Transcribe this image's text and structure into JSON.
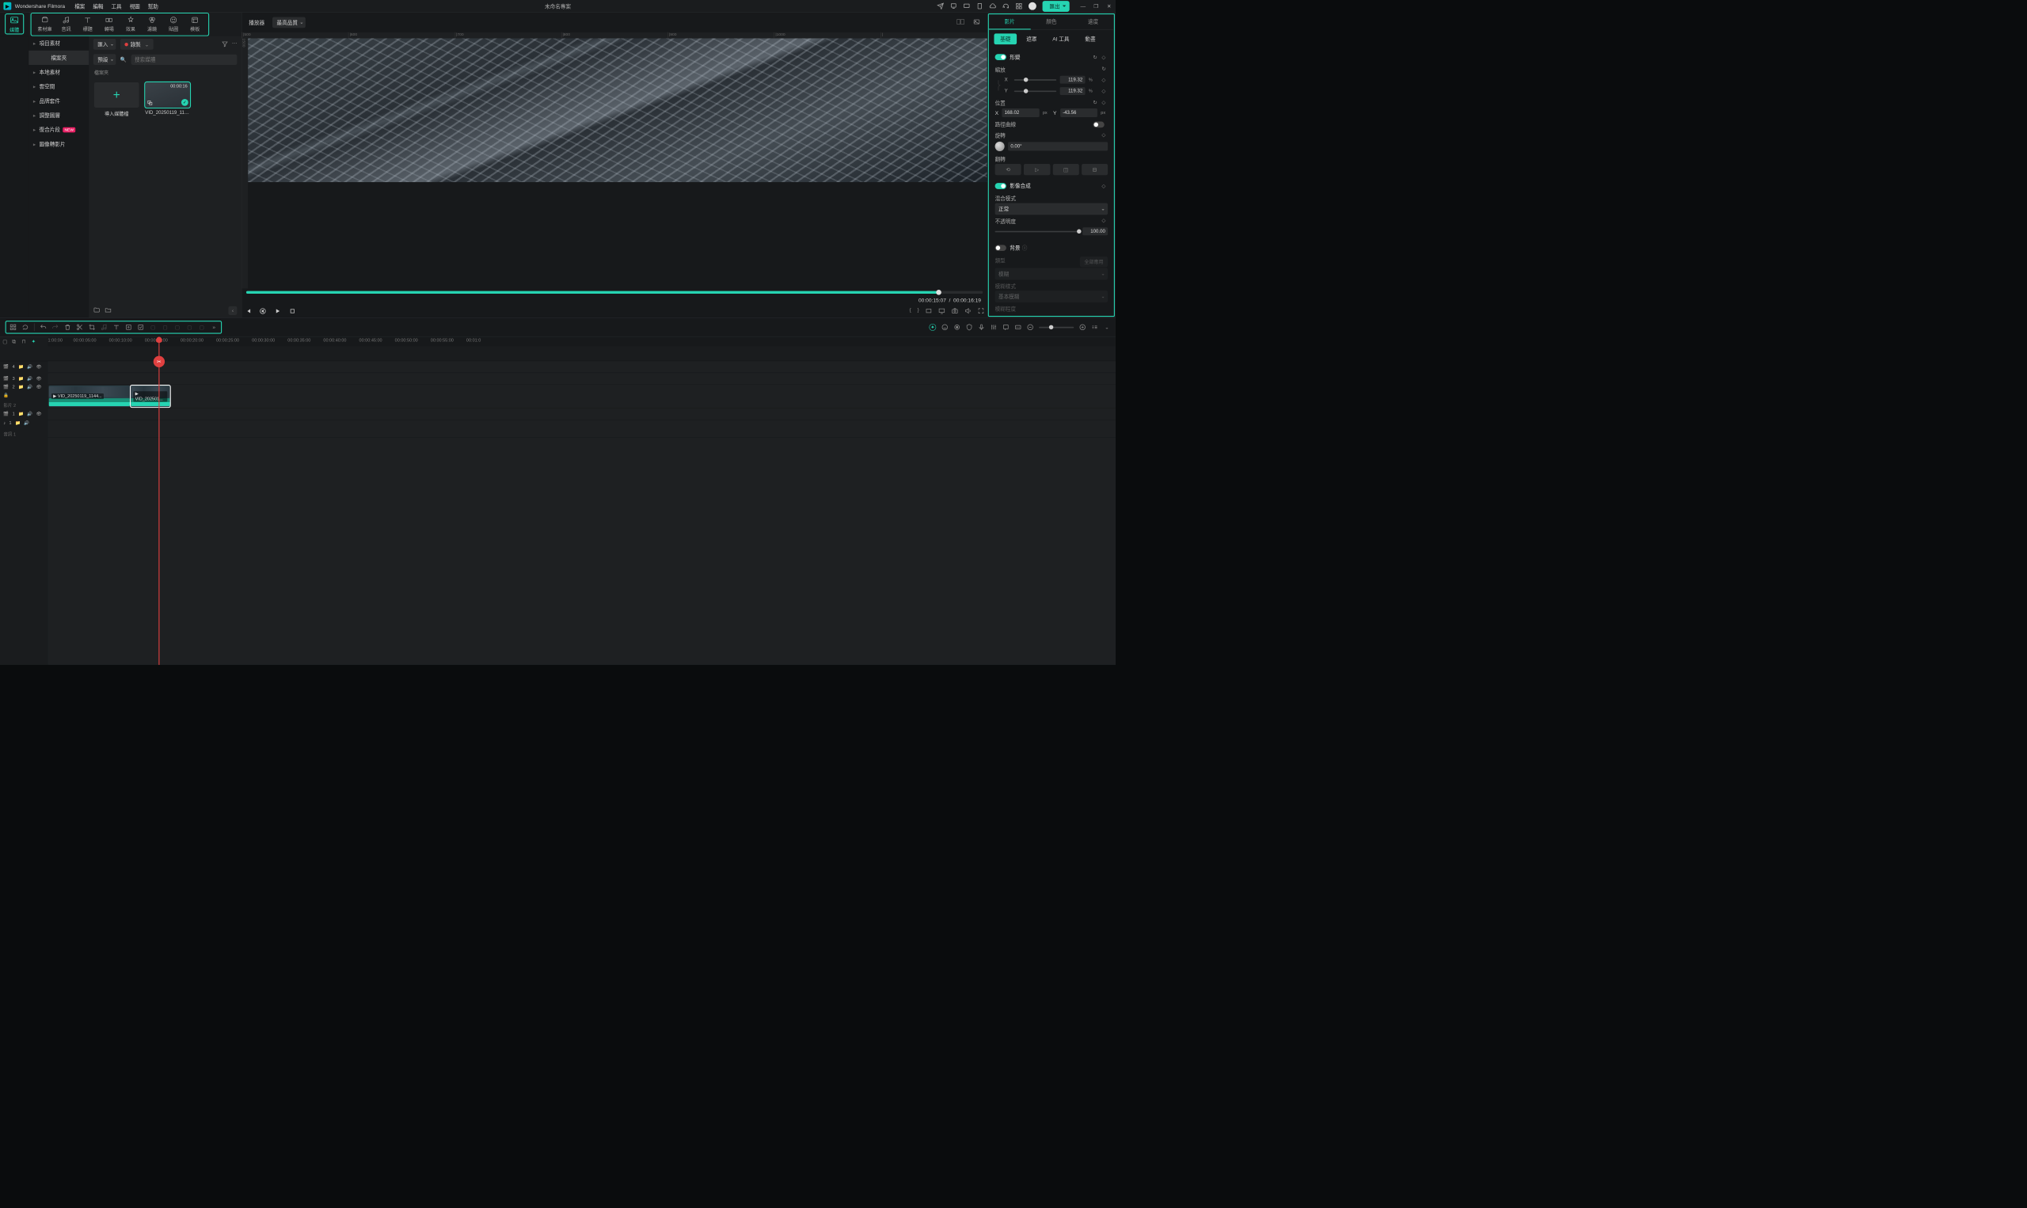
{
  "app": {
    "name": "Wondershare Filmora",
    "project": "未命名專案"
  },
  "menu": [
    "檔案",
    "編輯",
    "工具",
    "視圖",
    "幫助"
  ],
  "export_label": "匯出",
  "asset_tabs": {
    "active": "媒體",
    "items": [
      "素材庫",
      "音訊",
      "標題",
      "轉場",
      "效果",
      "濾鏡",
      "貼圖",
      "模板"
    ]
  },
  "sidebar": {
    "items": [
      {
        "label": "項目素材"
      },
      {
        "label": "檔案夾",
        "active": true,
        "sub": true
      },
      {
        "label": "本地素材"
      },
      {
        "label": "雲空間"
      },
      {
        "label": "品牌套件"
      },
      {
        "label": "調整圖層"
      },
      {
        "label": "復合片段",
        "badge": "NEW"
      },
      {
        "label": "圖像轉影片"
      }
    ]
  },
  "asset_toolbar": {
    "import": "匯入",
    "record": "錄製",
    "preset": "預設",
    "search_ph": "搜索媒體",
    "folder_label": "檔案夾"
  },
  "assets": {
    "import_label": "導入媒體檔",
    "clip": {
      "name": "VID_20250119_1144...",
      "duration": "00:00:16"
    }
  },
  "player": {
    "label": "播放器",
    "quality": "最高品質",
    "current": "00:00:15:07",
    "total": "00:00:16:19"
  },
  "right_panel": {
    "tabs": [
      "影片",
      "顏色",
      "速度"
    ],
    "subtabs": [
      "基礎",
      "遮罩",
      "AI 工具",
      "動畫"
    ],
    "transform": "形變",
    "scale": {
      "label": "縮放",
      "x": "119.32",
      "y": "119.32",
      "unit": "%"
    },
    "position": {
      "label": "位置",
      "x": "168.02",
      "y": "-43.56",
      "unit": "px"
    },
    "path_curve": "路徑曲線",
    "rotation": {
      "label": "旋轉",
      "value": "0.00°"
    },
    "flip": "翻轉",
    "compositing": {
      "label": "影像合成",
      "blend_label": "混合模式",
      "blend_value": "正常",
      "opacity_label": "不透明度",
      "opacity_value": "100.00"
    },
    "background": {
      "label": "背景",
      "type_label": "類型",
      "type_value": "模糊",
      "style_label": "模糊樣式",
      "style_value": "基本模糊",
      "degree_label": "模糊程度",
      "apply_all": "全部應用"
    }
  },
  "timeline": {
    "marks": [
      "00:00:05:00",
      "00:00:10:00",
      "00:00:15:00",
      "00:00:20:00",
      "00:00:25:00",
      "00:00:30:00",
      "00:00:35:00",
      "00:00:40:00",
      "00:00:45:00",
      "00:00:50:00",
      "00:00:55:00",
      "00:01:0"
    ],
    "tracks": {
      "v4": "4",
      "v3": "3",
      "v2": "2",
      "v2_label": "影片 2",
      "v1": "1",
      "a1": "1",
      "a1_label": "音訊 1"
    },
    "clip1": "VID_20250119_1144...",
    "clip2": "VID_202501..."
  }
}
